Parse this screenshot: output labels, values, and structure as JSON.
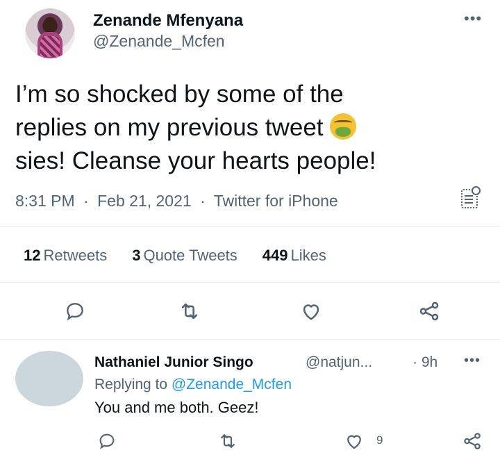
{
  "tweet": {
    "author_name": "Zenande Mfenyana",
    "author_handle": "@Zenande_Mcfen",
    "more_icon": "more-horizontal-icon",
    "text_line1": "I’m so shocked by some of the",
    "text_line2": "replies on my previous tweet",
    "text_emoji": "nauseated-face-emoji",
    "text_line3": "sies! Cleanse your hearts people!",
    "time": "8:31 PM",
    "date": "Feb 21, 2021",
    "source": "Twitter for iPhone",
    "sep": "·",
    "note_icon": "analytics-note-icon"
  },
  "stats": {
    "retweets_count": "12",
    "retweets_label": "Retweets",
    "quotes_count": "3",
    "quotes_label": "Quote Tweets",
    "likes_count": "449",
    "likes_label": "Likes"
  },
  "actions": {
    "reply_icon": "reply-icon",
    "retweet_icon": "retweet-icon",
    "like_icon": "heart-icon",
    "share_icon": "share-icon"
  },
  "reply": {
    "author_name": "Nathaniel Junior Singo",
    "author_handle": "@natjun...",
    "sep": "·",
    "time": "9h",
    "replying_prefix": "Replying to",
    "replying_handle": "@Zenande_Mcfen",
    "text": "You and me both. Geez!",
    "like_count": "9"
  },
  "colors": {
    "text": "#0f1419",
    "secondary": "#536471",
    "link": "#1d9bf0",
    "divider": "#e6ecf0"
  }
}
